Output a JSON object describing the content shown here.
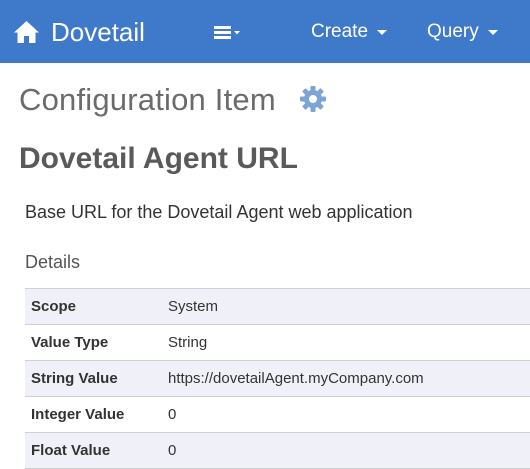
{
  "navbar": {
    "brand": {
      "label": "Dovetail",
      "icon": "home-icon"
    },
    "menu_toggle_icon": "list-menu-icon",
    "items": [
      {
        "label": "Create"
      },
      {
        "label": "Query"
      }
    ],
    "background_color": "#3f79c9"
  },
  "page": {
    "heading": "Configuration Item",
    "settings_icon": "gear-icon"
  },
  "item": {
    "title": "Dovetail Agent URL",
    "description": "Base URL for the Dovetail Agent web application"
  },
  "details": {
    "section_title": "Details",
    "rows": [
      {
        "key": "Scope",
        "value": "System"
      },
      {
        "key": "Value Type",
        "value": "String"
      },
      {
        "key": "String Value",
        "value": "https://dovetailAgent.myCompany.com"
      },
      {
        "key": "Integer Value",
        "value": "0"
      },
      {
        "key": "Float Value",
        "value": "0"
      }
    ]
  }
}
